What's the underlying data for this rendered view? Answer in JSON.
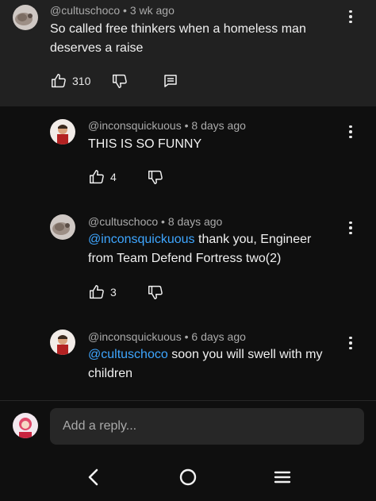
{
  "comments": [
    {
      "author": "@cultuschoco",
      "time": "3 wk ago",
      "text": "So called free thinkers when a homeless man deserves a raise",
      "likes": "310"
    },
    {
      "author": "@inconsquickuous",
      "time": "8 days ago",
      "text": "THIS IS SO FUNNY",
      "likes": "4"
    },
    {
      "author": "@cultuschoco",
      "time": "8 days ago",
      "mention": "@inconsquickuous",
      "text": "thank you, Engineer from Team Defend Fortress two(2)",
      "likes": "3"
    },
    {
      "author": "@inconsquickuous",
      "time": "6 days ago",
      "mention": "@cultuschoco",
      "text": "soon you will swell with my children"
    }
  ],
  "separator": "•",
  "reply": {
    "placeholder": "Add a reply..."
  },
  "icons": {
    "like": "thumbs-up-icon",
    "dislike": "thumbs-down-icon",
    "reply": "comment-icon",
    "more": "kebab-menu-icon",
    "nav_back": "chevron-left-icon",
    "nav_home": "circle-home-icon",
    "nav_recents": "menu-lines-icon"
  },
  "colors": {
    "mention": "#3ea6ff",
    "meta": "#aaaaaa",
    "parent_bg": "#212121"
  }
}
